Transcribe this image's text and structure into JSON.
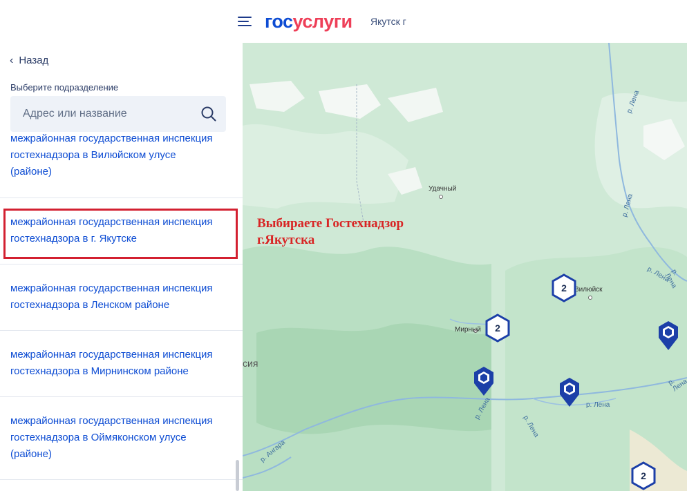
{
  "header": {
    "logo_part1": "гос",
    "logo_part2": "услуги",
    "region": "Якутск г"
  },
  "panel": {
    "back_label": "Назад",
    "subdivision_label": "Выберите подразделение",
    "search_placeholder": "Адрес или название",
    "items": [
      {
        "line1": "межрайонная государственная инспекция",
        "line2": "гостехнадзора в Вилюйском улусе",
        "line3": "(районе)"
      },
      {
        "line1": "межрайонная государственная инспекция",
        "line2": "гостехнадзора в г. Якутске"
      },
      {
        "line1": "межрайонная государственная инспекция",
        "line2": "гостехнадзора в Ленском районе"
      },
      {
        "line1": "межрайонная государственная инспекция",
        "line2": "гостехнадзора в Мирнинском районе"
      },
      {
        "line1": "межрайонная государственная инспекция",
        "line2": "гостехнадзора в Оймяконском улусе",
        "line3": "(районе)"
      }
    ]
  },
  "annotation": {
    "line1": "Выбираете Гостехнадзор",
    "line2": "г.Якутска"
  },
  "map": {
    "places": {
      "udachny": "Удачный",
      "vilyuysk": "Вилюйск",
      "mirny": "Мирный",
      "russia_fragment": "сия"
    },
    "rivers": {
      "lena": "р. Лена",
      "angara": "р. Ангара"
    },
    "clusters": [
      "2",
      "2",
      "2"
    ]
  },
  "colors": {
    "link": "#0d4cd3",
    "brand_red": "#ee3f58",
    "annotation": "#d82525",
    "marker": "#1c3fa8"
  }
}
